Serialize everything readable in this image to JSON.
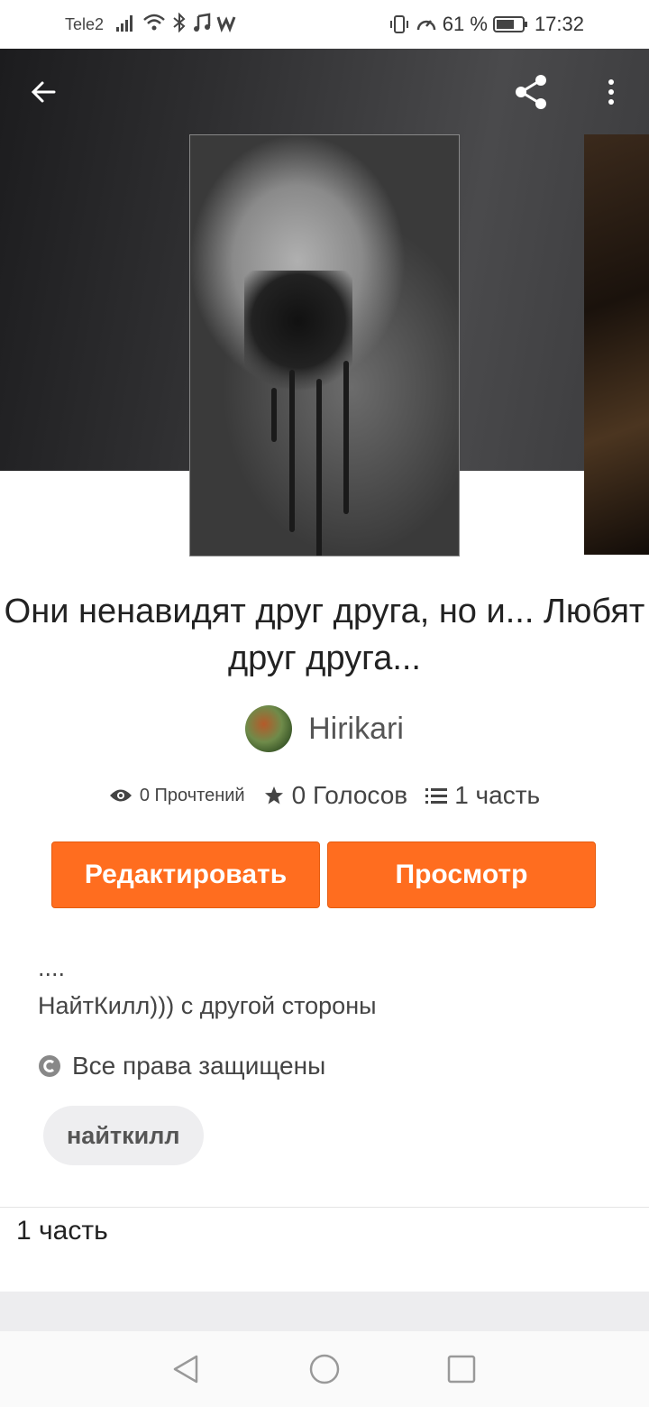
{
  "status_bar": {
    "carrier": "Tele2",
    "battery": "61 %",
    "time": "17:32"
  },
  "story": {
    "title": "Они ненавидят друг друга, но и... Любят друг друга...",
    "author": "Hirikari",
    "reads": "0 Прочтений",
    "votes": "0 Голосов",
    "parts": "1 часть",
    "description_line1": "....",
    "description_line2": "НайтКилл))) с другой стороны",
    "rights": "Все права защищены",
    "tag": "найткилл"
  },
  "actions": {
    "edit_label": "Редактировать",
    "view_label": "Просмотр"
  },
  "table_of_contents": {
    "title": "1 часть"
  },
  "icons": [
    "back-arrow-icon",
    "share-icon",
    "more-vert-icon",
    "eye-icon",
    "star-icon",
    "list-icon",
    "copyright-icon",
    "nav-back-icon",
    "nav-home-icon",
    "nav-recents-icon"
  ],
  "colors": {
    "accent": "#ff6d1f",
    "hero_bg": "#3a3a3c"
  }
}
